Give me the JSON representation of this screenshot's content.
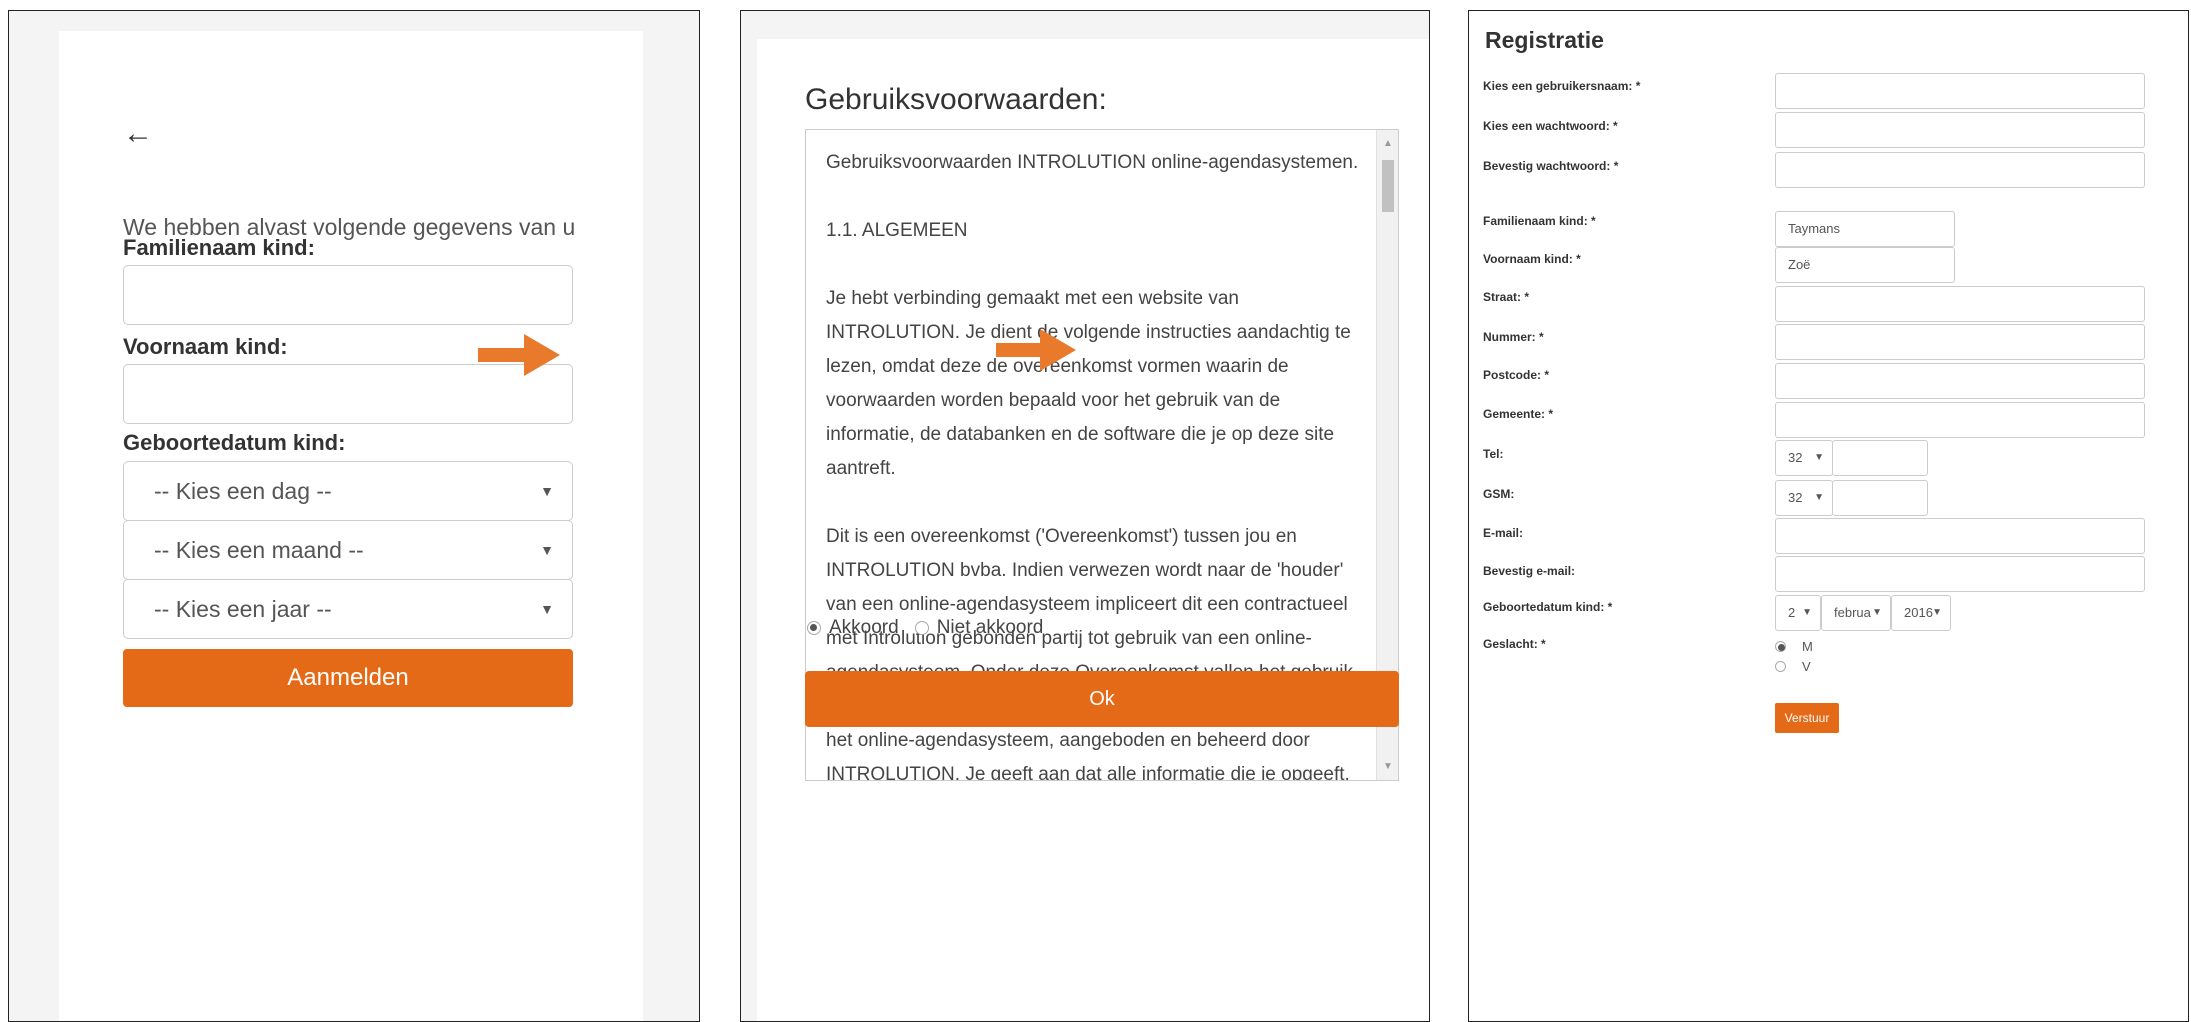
{
  "colors": {
    "accent": "#e56a17",
    "border": "#cccccc"
  },
  "screen1": {
    "back_icon": "arrow-left-icon",
    "intro": "We hebben alvast volgende gegevens van u nodig:",
    "familienaam_label": "Familienaam kind:",
    "voornaam_label": "Voornaam kind:",
    "geboortedatum_label": "Geboortedatum kind:",
    "day_select": "-- Kies een dag --",
    "month_select": "-- Kies een maand --",
    "year_select": "-- Kies een jaar --",
    "submit": "Aanmelden"
  },
  "screen2": {
    "title": "Gebruiksvoorwaarden:",
    "terms": [
      "Gebruiksvoorwaarden INTROLUTION online-agendasystemen.",
      "1.1. ALGEMEEN",
      "Je hebt verbinding gemaakt met een website van INTROLUTION. Je dient de volgende instructies aandachtig te lezen, omdat deze de overeenkomst vormen waarin de voorwaarden worden bepaald voor het gebruik van de informatie, de databanken en de software die je op deze site aantreft.",
      "Dit is een overeenkomst ('Overeenkomst') tussen jou en INTROLUTION bvba. Indien verwezen wordt naar de 'houder' van een online-agendasysteem impliceert dit een contractueel met Introlution gebonden partij tot gebruik van een online-agendasysteem. Onder deze Overeenkomst vallen het gebruik van elk website of webpagina die wordt aangeboden binnen het online-agendasysteem, aangeboden en beheerd door INTROLUTION. Je geeft aan dat alle informatie die je opgeeft, juist is."
    ],
    "agree": "Akkoord",
    "disagree": "Niet akkoord",
    "ok": "Ok"
  },
  "screen3": {
    "title": "Registratie",
    "labels": {
      "username": "Kies een gebruikersnaam: *",
      "password": "Kies een wachtwoord: *",
      "password_confirm": "Bevestig wachtwoord: *",
      "familienaam": "Familienaam kind: *",
      "voornaam": "Voornaam kind: *",
      "straat": "Straat: *",
      "nummer": "Nummer: *",
      "postcode": "Postcode: *",
      "gemeente": "Gemeente: *",
      "tel": "Tel:",
      "gsm": "GSM:",
      "email": "E-mail:",
      "email_confirm": "Bevestig e-mail:",
      "geboortedatum": "Geboortedatum kind: *",
      "geslacht": "Geslacht: *"
    },
    "values": {
      "familienaam": "Taymans",
      "voornaam": "Zoë",
      "tel_prefix": "32",
      "gsm_prefix": "32",
      "birth_day": "2",
      "birth_month": "februa",
      "birth_year": "2016"
    },
    "gender_m": "M",
    "gender_v": "V",
    "submit": "Verstuur"
  }
}
